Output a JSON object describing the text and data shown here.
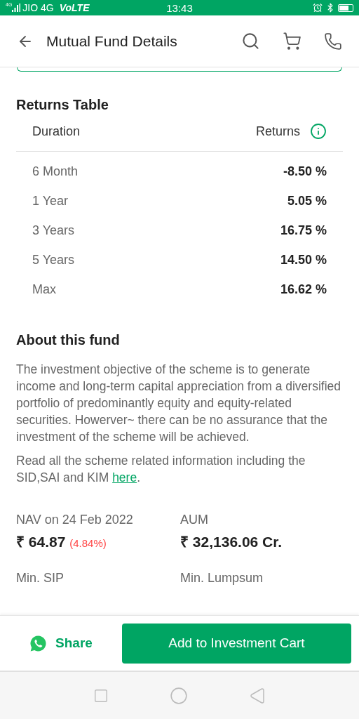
{
  "status_bar": {
    "network_tag": "4G",
    "carrier": "JIO 4G",
    "volte": "VoLTE",
    "time": "13:43"
  },
  "app_bar": {
    "title": "Mutual Fund Details"
  },
  "returns_table": {
    "title": "Returns Table",
    "columns": [
      "Duration",
      "Returns"
    ],
    "rows": [
      {
        "duration": "6 Month",
        "returns": "-8.50 %"
      },
      {
        "duration": "1 Year",
        "returns": "5.05 %"
      },
      {
        "duration": "3 Years",
        "returns": "16.75 %"
      },
      {
        "duration": "5 Years",
        "returns": "14.50 %"
      },
      {
        "duration": "Max",
        "returns": "16.62 %"
      }
    ]
  },
  "about": {
    "title": "About this fund",
    "description": "The investment objective of the scheme is to generate income and long-term capital appreciation from a diversified portfolio of predominantly equity and equity-related securities. Howerver~ there can be no assurance that the investment of the scheme will be achieved.",
    "info_text": "Read all the scheme related information including the SID,SAI and KIM ",
    "info_link": "here",
    "info_after": "."
  },
  "stats": [
    {
      "label": "NAV on 24 Feb 2022",
      "value": "₹ 64.87",
      "change": "(4.84%)"
    },
    {
      "label": "AUM",
      "value": "₹ 32,136.06 Cr."
    },
    {
      "label": "Min. SIP"
    },
    {
      "label": "Min. Lumpsum"
    }
  ],
  "bottom_bar": {
    "share": "Share",
    "cta": "Add to Investment Cart"
  }
}
